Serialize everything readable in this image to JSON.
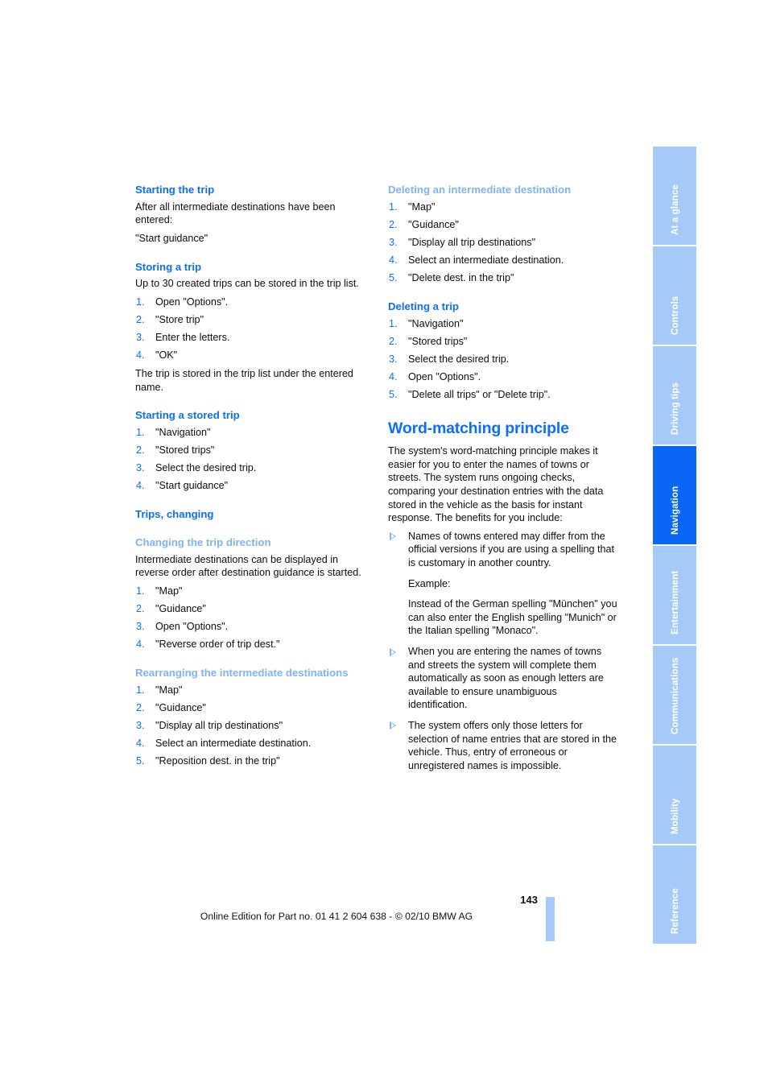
{
  "document": {
    "page_number": "143",
    "footer_note": "Online Edition for Part no. 01 41 2 604 638 - © 02/10 BMW AG",
    "colors": {
      "heading_blue": "#0d6efd",
      "subheading_blue": "#7fb3f2",
      "tab_inactive": "#a6caf8",
      "tab_active": "#0a66f5",
      "body_text": "#0d0d0d"
    }
  },
  "left_column": {
    "starting_the_trip": {
      "heading": "Starting the trip",
      "para1": "After all intermediate destinations have been entered:",
      "para2": "\"Start guidance\""
    },
    "storing_a_trip": {
      "heading": "Storing a trip",
      "intro": "Up to 30 created trips can be stored in the trip list.",
      "steps": [
        "Open \"Options\".",
        "\"Store trip\"",
        "Enter the letters.",
        "\"OK\""
      ],
      "outro": "The trip is stored in the trip list under the entered name."
    },
    "starting_a_stored_trip": {
      "heading": "Starting a stored trip",
      "steps": [
        "\"Navigation\"",
        "\"Stored trips\"",
        "Select the desired trip.",
        "\"Start guidance\""
      ]
    },
    "trips_changing": {
      "heading": "Trips, changing"
    },
    "changing_the_trip_direction": {
      "heading": "Changing the trip direction",
      "intro": "Intermediate destinations can be displayed in reverse order after destination guidance is started.",
      "steps": [
        "\"Map\"",
        "\"Guidance\"",
        "Open \"Options\".",
        "\"Reverse order of trip dest.\""
      ]
    },
    "rearranging_the_intermediate_destinations": {
      "heading": "Rearranging the intermediate destinations",
      "steps": [
        "\"Map\"",
        "\"Guidance\"",
        "\"Display all trip destinations\"",
        "Select an intermediate destination.",
        "\"Reposition dest. in the trip\""
      ]
    }
  },
  "right_column": {
    "deleting_an_intermediate_destination": {
      "heading": "Deleting an intermediate destination",
      "steps": [
        "\"Map\"",
        "\"Guidance\"",
        "\"Display all trip destinations\"",
        "Select an intermediate destination.",
        "\"Delete dest. in the trip\""
      ]
    },
    "deleting_a_trip": {
      "heading": "Deleting a trip",
      "steps": [
        "\"Navigation\"",
        "\"Stored trips\"",
        "Select the desired trip.",
        "Open \"Options\".",
        "\"Delete all trips\" or \"Delete trip\"."
      ]
    },
    "word_matching_principle": {
      "heading": "Word-matching principle",
      "intro": "The system's word-matching principle makes it easier for you to enter the names of towns or streets. The system runs ongoing checks, comparing your destination entries with the data stored in the vehicle as the basis for instant response. The benefits for you include:",
      "bullets": [
        {
          "text": "Names of towns entered may differ from the official versions if you are using a spelling that is customary in another country.",
          "sub": [
            "Example:",
            "Instead of the German spelling \"München\" you can also enter the English spelling \"Munich\" or the Italian spelling \"Monaco\"."
          ]
        },
        {
          "text": "When you are entering the names of towns and streets the system will complete them automatically as soon as enough letters are available to ensure unambiguous identification.",
          "sub": []
        },
        {
          "text": "The system offers only those letters for selection of name entries that are stored in the vehicle. Thus, entry of erroneous or unregistered names is impossible.",
          "sub": []
        }
      ]
    }
  },
  "side_tabs": [
    {
      "label": "At a glance",
      "active": false
    },
    {
      "label": "Controls",
      "active": false
    },
    {
      "label": "Driving tips",
      "active": false
    },
    {
      "label": "Navigation",
      "active": true
    },
    {
      "label": "Entertainment",
      "active": false
    },
    {
      "label": "Communications",
      "active": false
    },
    {
      "label": "Mobility",
      "active": false
    },
    {
      "label": "Reference",
      "active": false
    }
  ]
}
